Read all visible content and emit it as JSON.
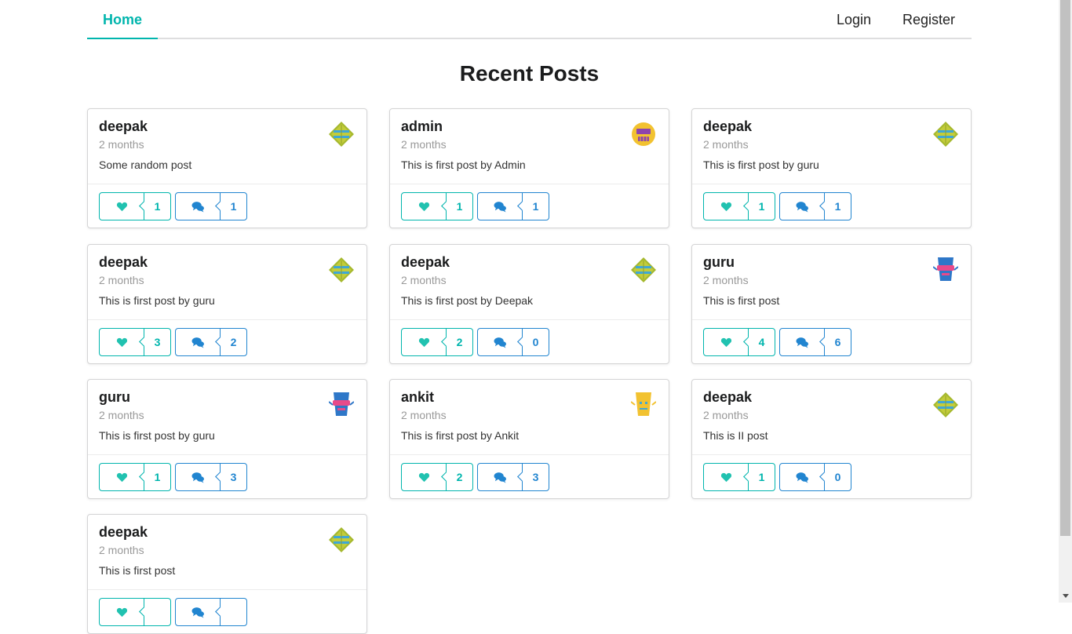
{
  "nav": {
    "home": "Home",
    "login": "Login",
    "register": "Register"
  },
  "page_title": "Recent Posts",
  "colors": {
    "accent": "#00b5ad",
    "comment": "#2185d0"
  },
  "posts": [
    {
      "author": "deepak",
      "time": "2 months",
      "text": "Some random post",
      "likes": "1",
      "comments": "1",
      "avatar": "green-diamond"
    },
    {
      "author": "admin",
      "time": "2 months",
      "text": "This is first post by Admin",
      "likes": "1",
      "comments": "1",
      "avatar": "yellow-robot"
    },
    {
      "author": "deepak",
      "time": "2 months",
      "text": "This is first post by guru",
      "likes": "1",
      "comments": "1",
      "avatar": "green-diamond"
    },
    {
      "author": "deepak",
      "time": "2 months",
      "text": "This is first post by guru",
      "likes": "3",
      "comments": "2",
      "avatar": "green-diamond"
    },
    {
      "author": "deepak",
      "time": "2 months",
      "text": "This is first post by Deepak",
      "likes": "2",
      "comments": "0",
      "avatar": "green-diamond"
    },
    {
      "author": "guru",
      "time": "2 months",
      "text": "This is first post",
      "likes": "4",
      "comments": "6",
      "avatar": "blue-robot"
    },
    {
      "author": "guru",
      "time": "2 months",
      "text": "This is first post by guru",
      "likes": "1",
      "comments": "3",
      "avatar": "blue-robot"
    },
    {
      "author": "ankit",
      "time": "2 months",
      "text": "This is first post by Ankit",
      "likes": "2",
      "comments": "3",
      "avatar": "yellow-mask"
    },
    {
      "author": "deepak",
      "time": "2 months",
      "text": "This is II post",
      "likes": "1",
      "comments": "0",
      "avatar": "green-diamond"
    },
    {
      "author": "deepak",
      "time": "2 months",
      "text": "This is first post",
      "likes": "",
      "comments": "",
      "avatar": "green-diamond"
    }
  ]
}
